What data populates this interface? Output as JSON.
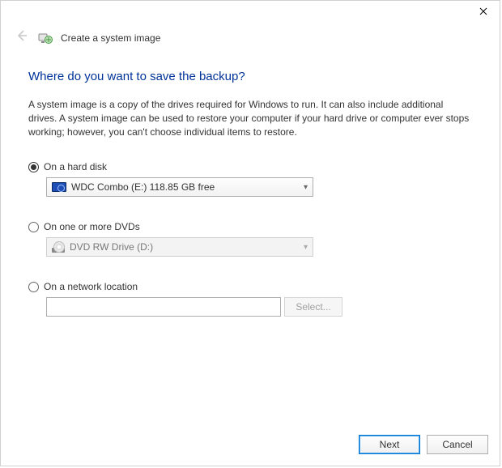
{
  "window": {
    "title": "Create a system image"
  },
  "heading": "Where do you want to save the backup?",
  "description": "A system image is a copy of the drives required for Windows to run. It can also include additional drives. A system image can be used to restore your computer if your hard drive or computer ever stops working; however, you can't choose individual items to restore.",
  "options": {
    "hard_disk": {
      "label": "On a hard disk",
      "selected_value": "WDC Combo (E:)  118.85 GB free"
    },
    "dvd": {
      "label": "On one or more DVDs",
      "selected_value": "DVD RW Drive (D:)"
    },
    "network": {
      "label": "On a network location",
      "select_button": "Select..."
    }
  },
  "footer": {
    "next": "Next",
    "cancel": "Cancel"
  }
}
